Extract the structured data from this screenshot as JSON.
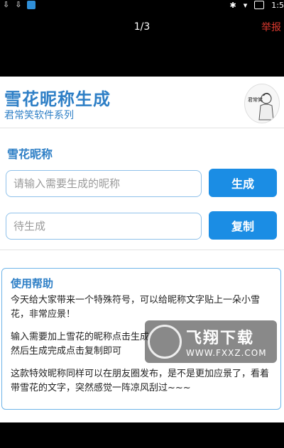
{
  "status_bar": {
    "left_glyphs": [
      "⇩",
      "⇩"
    ],
    "right_glyphs": [
      "✱",
      "▾"
    ],
    "time": "1:5"
  },
  "viewer": {
    "page_indicator": "1/3",
    "report_label": "举报"
  },
  "app": {
    "title": "雪花昵称生成",
    "subtitle": "君常笑软件系列",
    "logo_text": "君常笑",
    "section_title": "雪花昵称",
    "name_input": {
      "placeholder": "请输入需要生成的昵称",
      "value": ""
    },
    "generate_label": "生成",
    "result_input": {
      "placeholder": "待生成",
      "value": ""
    },
    "copy_label": "复制",
    "help": {
      "title": "使用帮助",
      "paragraphs": [
        "今天给大家带来一个特殊符号，可以给昵称文字贴上一朵小雪花，非常应景！",
        "输入需要加上雪花的昵称点击生成\n然后生成完成点击复制即可",
        "这款特效昵称同样可以在朋友圈发布，是不是更加应景了，看着带雪花的文字，突然感觉一阵凉风刮过~~~"
      ]
    }
  },
  "watermark": {
    "big": "飞翔下载",
    "small": "WWW.FXXZ.COM"
  },
  "colors": {
    "accent": "#2e7fc6",
    "button": "#1b8de4",
    "report": "#e03a2f"
  }
}
